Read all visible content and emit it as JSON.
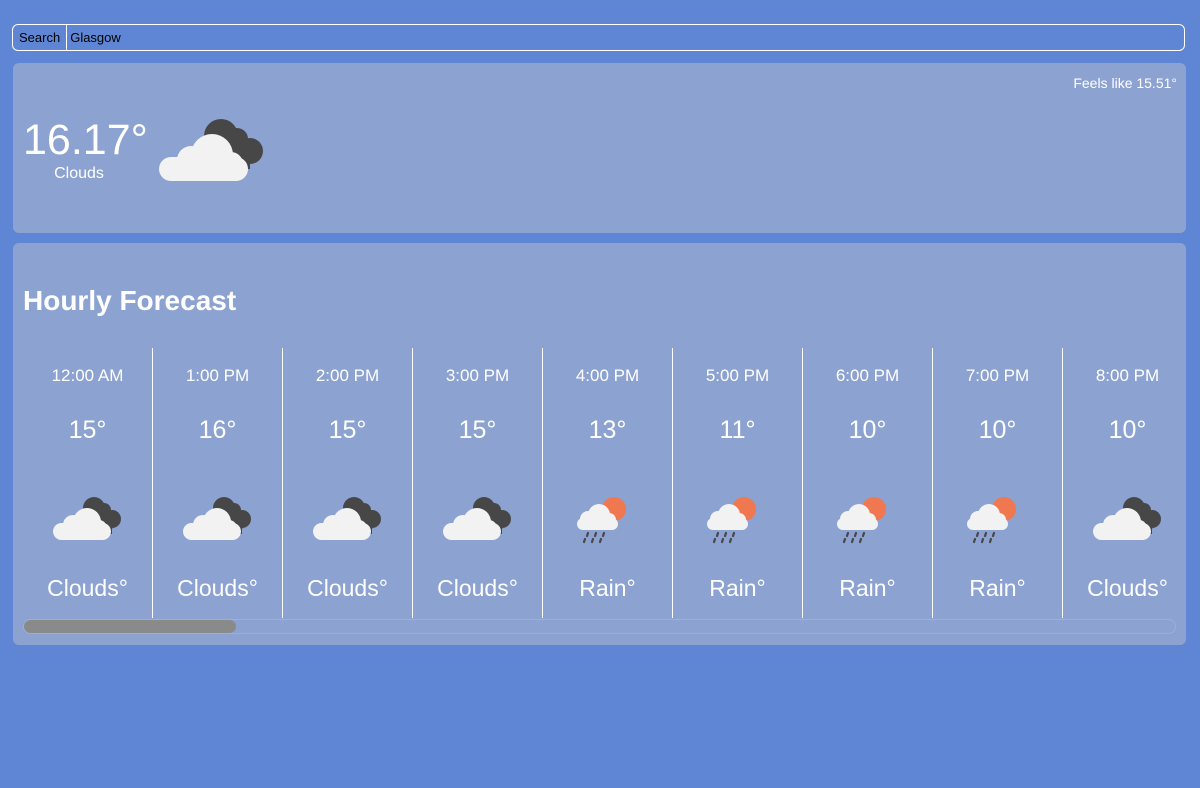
{
  "search": {
    "button_label": "Search",
    "value": "Glasgow",
    "placeholder": ""
  },
  "current": {
    "temp": "16.17°",
    "description": "Clouds",
    "feels_like": "Feels like 15.51°",
    "icon": "clouds-icon"
  },
  "hourly": {
    "title": "Hourly Forecast",
    "items": [
      {
        "time": "12:00 AM",
        "temp": "15°",
        "desc": "Clouds°",
        "icon": "clouds-icon"
      },
      {
        "time": "1:00 PM",
        "temp": "16°",
        "desc": "Clouds°",
        "icon": "clouds-icon"
      },
      {
        "time": "2:00 PM",
        "temp": "15°",
        "desc": "Clouds°",
        "icon": "clouds-icon"
      },
      {
        "time": "3:00 PM",
        "temp": "15°",
        "desc": "Clouds°",
        "icon": "clouds-icon"
      },
      {
        "time": "4:00 PM",
        "temp": "13°",
        "desc": "Rain°",
        "icon": "rain-sun-icon"
      },
      {
        "time": "5:00 PM",
        "temp": "11°",
        "desc": "Rain°",
        "icon": "rain-sun-icon"
      },
      {
        "time": "6:00 PM",
        "temp": "10°",
        "desc": "Rain°",
        "icon": "rain-sun-icon"
      },
      {
        "time": "7:00 PM",
        "temp": "10°",
        "desc": "Rain°",
        "icon": "rain-sun-icon"
      },
      {
        "time": "8:00 PM",
        "temp": "10°",
        "desc": "Clouds°",
        "icon": "clouds-icon"
      }
    ]
  },
  "colors": {
    "background": "#5f86d4",
    "panel": "#8ca2d1",
    "sun": "#f07850",
    "cloud_light": "#f2f2f2",
    "cloud_dark": "#474747"
  }
}
